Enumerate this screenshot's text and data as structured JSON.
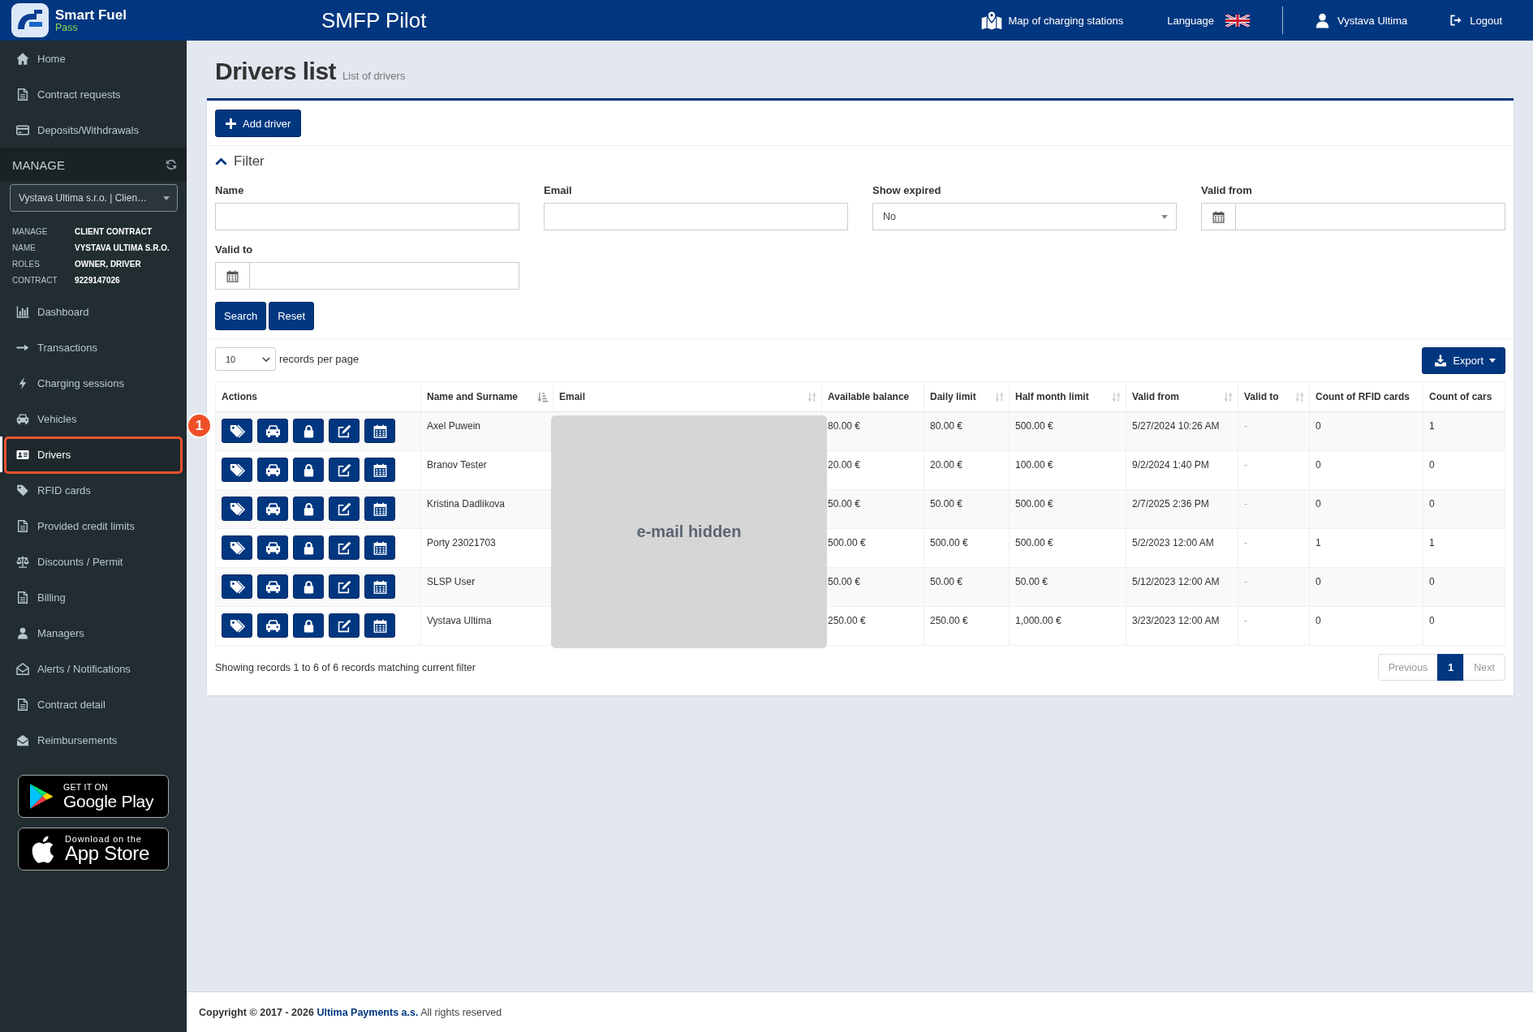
{
  "header": {
    "brand": {
      "name": "Smart Fuel",
      "sub": "Pass"
    },
    "app_title": "SMFP Pilot",
    "map_link": "Map of charging stations",
    "language_label": "Language",
    "user_name": "Vystava Ultima",
    "logout_label": "Logout"
  },
  "sidebar": {
    "top_items": [
      {
        "label": "Home",
        "selected": false
      },
      {
        "label": "Contract requests",
        "selected": false
      },
      {
        "label": "Deposits/Withdrawals",
        "selected": false
      }
    ],
    "section_title": "MANAGE",
    "contract_select": "Vystava Ultima s.r.o. | Clien…",
    "info": [
      {
        "label": "MANAGE",
        "value": "CLIENT CONTRACT"
      },
      {
        "label": "NAME",
        "value": "VYSTAVA ULTIMA S.R.O."
      },
      {
        "label": "ROLES",
        "value": "OWNER, DRIVER"
      },
      {
        "label": "CONTRACT",
        "value": "9229147026"
      }
    ],
    "items": [
      {
        "label": "Dashboard",
        "selected": false
      },
      {
        "label": "Transactions",
        "selected": false
      },
      {
        "label": "Charging sessions",
        "selected": false
      },
      {
        "label": "Vehicles",
        "selected": false
      },
      {
        "label": "Drivers",
        "selected": true,
        "callout": "1"
      },
      {
        "label": "RFID cards",
        "selected": false
      },
      {
        "label": "Provided credit limits",
        "selected": false
      },
      {
        "label": "Discounts / Permit",
        "selected": false
      },
      {
        "label": "Billing",
        "selected": false
      },
      {
        "label": "Managers",
        "selected": false
      },
      {
        "label": "Alerts / Notifications",
        "selected": false
      },
      {
        "label": "Contract detail",
        "selected": false
      },
      {
        "label": "Reimbursements",
        "selected": false
      }
    ],
    "store_badges": [
      {
        "kind": "google",
        "small": "GET IT ON",
        "large": "Google Play"
      },
      {
        "kind": "apple",
        "small": "Download on the",
        "large": "App Store"
      }
    ]
  },
  "page": {
    "title": "Drivers list",
    "subtitle": "List of drivers"
  },
  "toolbar": {
    "add_button": "Add driver"
  },
  "filter": {
    "title": "Filter",
    "expanded": true,
    "fields": [
      {
        "label": "Name",
        "kind": "text"
      },
      {
        "label": "Email",
        "kind": "text"
      },
      {
        "label": "Show expired",
        "kind": "select",
        "value": "No"
      },
      {
        "label": "Valid from",
        "kind": "date"
      },
      {
        "label": "Valid to",
        "kind": "date"
      }
    ],
    "buttons": [
      "Search",
      "Reset"
    ]
  },
  "table": {
    "page_length": "10",
    "page_length_label": "records per page",
    "export_button": "Export",
    "columns": [
      {
        "label": "Actions",
        "kind": "actions",
        "sortable": false,
        "sorted": false
      },
      {
        "label": "Name and Surname",
        "kind": "text",
        "sortable": true,
        "sorted": true
      },
      {
        "label": "Email",
        "kind": "masked",
        "sortable": true,
        "sorted": false
      },
      {
        "label": "Available balance",
        "kind": "text",
        "sortable": false,
        "sorted": false
      },
      {
        "label": "Daily limit",
        "kind": "text",
        "sortable": true,
        "sorted": false
      },
      {
        "label": "Half month limit",
        "kind": "text",
        "sortable": true,
        "sorted": false
      },
      {
        "label": "Valid from",
        "kind": "text",
        "sortable": true,
        "sorted": false
      },
      {
        "label": "Valid to",
        "kind": "dim",
        "sortable": true,
        "sorted": false
      },
      {
        "label": "Count of RFID cards",
        "kind": "text",
        "sortable": false,
        "sorted": false
      },
      {
        "label": "Count of cars",
        "kind": "text",
        "sortable": false,
        "sorted": false
      }
    ],
    "rows": [
      {
        "cells": [
          "",
          "Axel Puwein",
          "",
          "80.00 €",
          "80.00 €",
          "500.00 €",
          "5/27/2024 10:26 AM",
          "-",
          "0",
          "1"
        ]
      },
      {
        "cells": [
          "",
          "Branov Tester",
          "",
          "20.00 €",
          "20.00 €",
          "100.00 €",
          "9/2/2024 1:40 PM",
          "-",
          "0",
          "0"
        ]
      },
      {
        "cells": [
          "",
          "Kristina Dadlikova",
          "",
          "50.00 €",
          "50.00 €",
          "500.00 €",
          "2/7/2025 2:36 PM",
          "-",
          "0",
          "0"
        ]
      },
      {
        "cells": [
          "",
          "Porty 23021703",
          "",
          "500.00 €",
          "500.00 €",
          "500.00 €",
          "5/2/2023 12:00 AM",
          "-",
          "1",
          "1"
        ]
      },
      {
        "cells": [
          "",
          "SLSP User",
          "",
          "50.00 €",
          "50.00 €",
          "50.00 €",
          "5/12/2023 12:00 AM",
          "-",
          "0",
          "0"
        ]
      },
      {
        "cells": [
          "",
          "Vystava Ultima",
          "",
          "250.00 €",
          "250.00 €",
          "1,000.00 €",
          "3/23/2023 12:00 AM",
          "-",
          "0",
          "0"
        ]
      }
    ],
    "email_mask": "e-mail hidden",
    "info": "Showing records 1 to 6 of 6 records matching current filter",
    "pagination": {
      "previous": {
        "label": "Previous",
        "disabled": true
      },
      "pages": [
        {
          "label": "1",
          "selected": true
        }
      ],
      "next": {
        "label": "Next",
        "disabled": true
      }
    }
  },
  "footer": {
    "copyright": "Copyright © 2017 - 2026",
    "company": "Ultima Payments a.s.",
    "rights": "All rights reserved"
  }
}
